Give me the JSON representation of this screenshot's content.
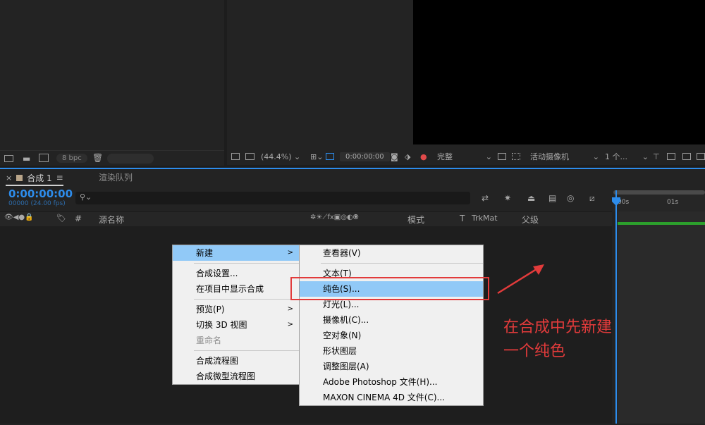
{
  "project_panel": {
    "bpc": "8 bpc"
  },
  "viewer_bar": {
    "zoom": "(44.4%)",
    "timecode": "0:00:00:00",
    "resolution": "完整",
    "camera": "活动摄像机",
    "views": "1 个..."
  },
  "timeline": {
    "tab_label": "合成 1",
    "tab2_label": "渲染队列",
    "timecode": "0:00:00:00",
    "fps": "00000 (24.00 fps)",
    "cols": {
      "hash": "#",
      "source": "源名称",
      "mode": "模式",
      "t": "T",
      "trkmat": "TrkMat",
      "parent": "父级"
    },
    "ruler_0": "00s",
    "ruler_1": "01s"
  },
  "context_menu": {
    "items": [
      {
        "label": "新建",
        "submenu": true,
        "highlight": true
      },
      {
        "label": "合成设置..."
      },
      {
        "label": "在项目中显示合成"
      },
      {
        "label": "预览(P)",
        "submenu": true
      },
      {
        "label": "切换 3D 视图",
        "submenu": true
      },
      {
        "label": "重命名",
        "disabled": true
      },
      {
        "label": "合成流程图"
      },
      {
        "label": "合成微型流程图"
      }
    ]
  },
  "submenu": {
    "items": [
      {
        "label": "查看器(V)"
      },
      {
        "label": "文本(T)"
      },
      {
        "label": "纯色(S)...",
        "highlight": true
      },
      {
        "label": "灯光(L)..."
      },
      {
        "label": "摄像机(C)..."
      },
      {
        "label": "空对象(N)"
      },
      {
        "label": "形状图层"
      },
      {
        "label": "调整图层(A)"
      },
      {
        "label": "Adobe Photoshop 文件(H)..."
      },
      {
        "label": "MAXON CINEMA 4D 文件(C)..."
      }
    ]
  },
  "annotation": {
    "line1": "在合成中先新建",
    "line2": "一个纯色",
    "color": "#e23b3b"
  }
}
